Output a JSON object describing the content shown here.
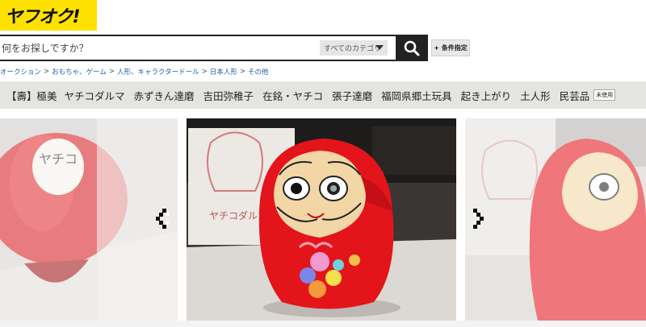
{
  "logo": {
    "text": "ヤフオク!",
    "color": "#ffe100"
  },
  "search": {
    "placeholder": "何をお探しですか？",
    "category_label": "すべてのカテゴリ",
    "filter_label": "+ 条件指定"
  },
  "breadcrumb": [
    "オークション",
    "おもちゃ、ゲーム",
    "人形、キャラクタードール",
    "日本人形",
    "その他"
  ],
  "tags": [
    {
      "label": "【壽】極美"
    },
    {
      "label": "ヤチコダルマ"
    },
    {
      "label": "赤ずきん達磨"
    },
    {
      "label": "吉田弥稚子"
    },
    {
      "label": "在銘・ヤチコ"
    },
    {
      "label": "張子達磨"
    },
    {
      "label": "福岡県郷土玩具"
    },
    {
      "label": "起き上がり"
    },
    {
      "label": "土人形"
    },
    {
      "label": "民芸品"
    }
  ],
  "condition_badge": "未使用",
  "gallery": {
    "images": [
      {
        "name": "daruma-back-photo",
        "label_text": "ヤチコ"
      },
      {
        "name": "daruma-front-photo",
        "box_text": "ヤチコダルマ"
      },
      {
        "name": "daruma-side-photo"
      }
    ],
    "icons": {
      "prev": "chevron-left-icon",
      "next": "chevron-right-icon",
      "search": "search-icon"
    }
  }
}
